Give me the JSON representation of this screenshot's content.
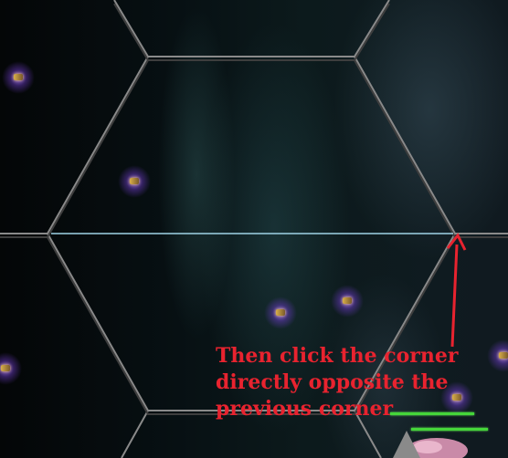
{
  "tutorial": {
    "lines": [
      "Then click the corner",
      "directly opposite the",
      "previous corner"
    ],
    "color": "#e8232f"
  },
  "colors": {
    "grid_line": "#9a9a9a",
    "measure_line": "#9fd3e6",
    "arrow": "#e8232f",
    "fleet_glow": "#9b5cff",
    "health_bar": "#45d63a"
  },
  "icons": [
    "fleet-icon",
    "arrow-icon",
    "planet-icon"
  ]
}
